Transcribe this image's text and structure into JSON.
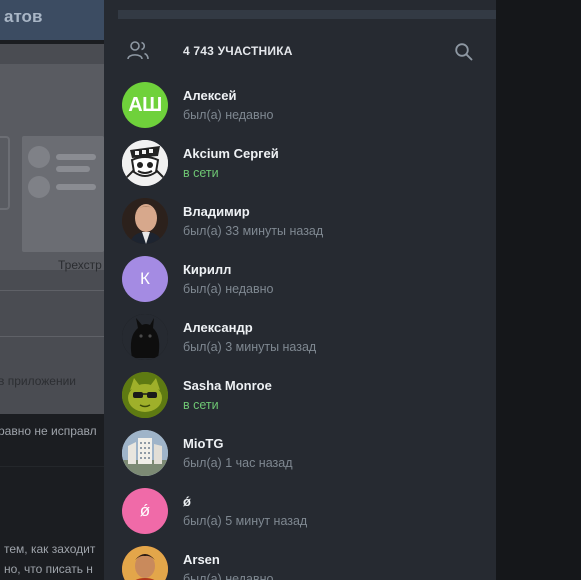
{
  "background": {
    "header_title": "атов",
    "card_caption": "Трехстр",
    "mid_text": "в приложении",
    "lower_text": "равно не исправл",
    "bottom_text_1": "тем, как заходит",
    "bottom_text_2": "но, что писать н"
  },
  "panel": {
    "members_count": "4 743 УЧАСТНИКА",
    "members": [
      {
        "name": "Алексей",
        "status": "был(а) недавно",
        "online": false,
        "avatar_text": "АШ",
        "avatar_color": "#6fd13b"
      },
      {
        "name": "Akcium Сергей",
        "status": "в сети",
        "online": true,
        "avatar_text": "",
        "avatar_color": "#e9e9e9"
      },
      {
        "name": "Владимир",
        "status": "был(а) 33 минуты назад",
        "online": false,
        "avatar_text": "",
        "avatar_color": "#3a2a22"
      },
      {
        "name": "Кирилл",
        "status": "был(а) недавно",
        "online": false,
        "avatar_text": "К",
        "avatar_color": "#a48be3"
      },
      {
        "name": "Александр",
        "status": "был(а) 3 минуты назад",
        "online": false,
        "avatar_text": "",
        "avatar_color": "#131313"
      },
      {
        "name": "Sasha Monroe",
        "status": "в сети",
        "online": true,
        "avatar_text": "",
        "avatar_color": "#7a8a1a"
      },
      {
        "name": "MioTG",
        "status": "был(а) 1 час назад",
        "online": false,
        "avatar_text": "",
        "avatar_color": "#b9c6d4"
      },
      {
        "name": "ǿ",
        "status": "был(а) 5 минут назад",
        "online": false,
        "avatar_text": "ǿ",
        "avatar_color": "#f06aa8"
      },
      {
        "name": "Arsen",
        "status": "был(а) недавно",
        "online": false,
        "avatar_text": "",
        "avatar_color": "#c0502a"
      }
    ]
  },
  "icons": {
    "members": "people-icon",
    "search": "search-icon"
  }
}
